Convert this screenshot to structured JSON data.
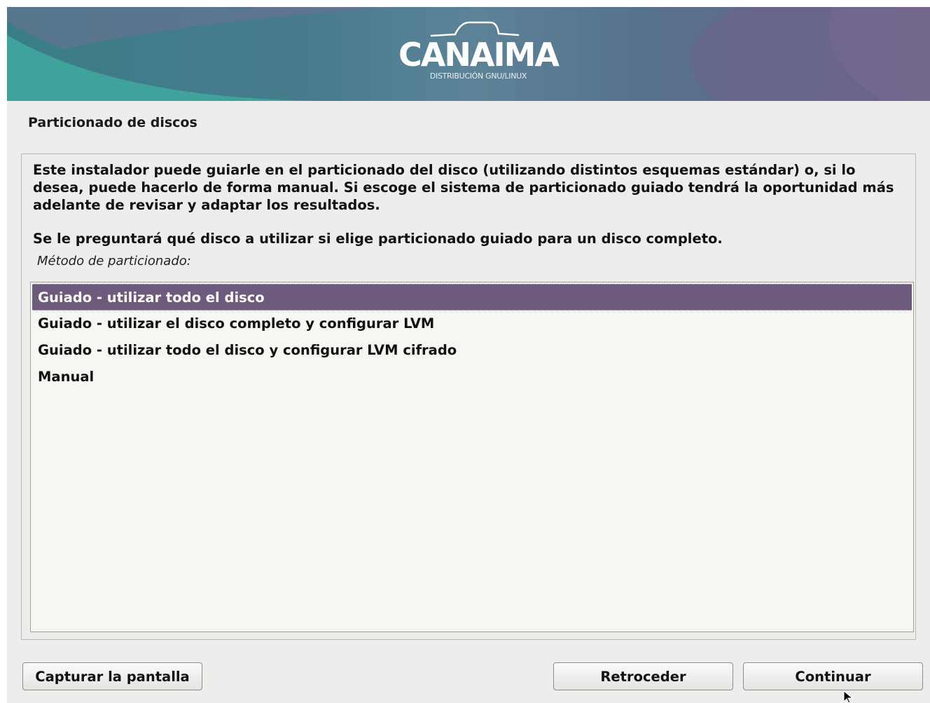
{
  "banner": {
    "brand": "CANAIMA",
    "tagline": "DISTRIBUCIÓN GNU/LINUX",
    "colors": {
      "teal": "#3f9c9a",
      "blue": "#4b6f8a",
      "purple": "#6e6386"
    }
  },
  "page": {
    "title": "Particionado de discos"
  },
  "content": {
    "description": "Este instalador puede guiarle en el particionado del disco (utilizando distintos esquemas estándar) o, si lo desea, puede hacerlo de forma manual. Si escoge el sistema de particionado guiado tendrá la oportunidad más adelante de revisar y adaptar los resultados.",
    "question": "Se le preguntará qué disco a utilizar si elige particionado guiado para un disco completo.",
    "list_label": "Método de particionado:",
    "options": [
      {
        "label": "Guiado - utilizar todo el disco",
        "selected": true
      },
      {
        "label": "Guiado - utilizar el disco completo y configurar LVM",
        "selected": false
      },
      {
        "label": "Guiado - utilizar todo el disco y configurar LVM cifrado",
        "selected": false
      },
      {
        "label": "Manual",
        "selected": false
      }
    ],
    "selection_color": "#6d5a7c"
  },
  "buttons": {
    "screenshot": "Capturar la pantalla",
    "back": "Retroceder",
    "continue": "Continuar"
  }
}
